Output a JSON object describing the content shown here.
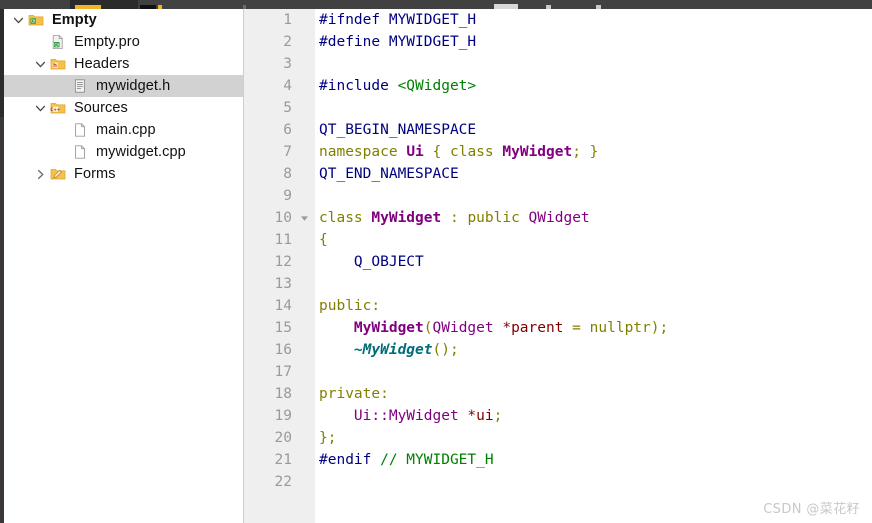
{
  "window": {
    "toolbar_strip_label": "toolbar (cropped)"
  },
  "sidebar": {
    "items": [
      {
        "label": "Empty",
        "icon": "qt-folder-icon",
        "indent": 0,
        "twisty": "expanded",
        "bold": true,
        "selected": false
      },
      {
        "label": "Empty.pro",
        "icon": "qt-profile-file-icon",
        "indent": 1,
        "twisty": "none",
        "bold": false,
        "selected": false
      },
      {
        "label": "Headers",
        "icon": "headers-folder-icon",
        "indent": 1,
        "twisty": "expanded",
        "bold": false,
        "selected": false
      },
      {
        "label": "mywidget.h",
        "icon": "header-file-icon",
        "indent": 2,
        "twisty": "none",
        "bold": false,
        "selected": true
      },
      {
        "label": "Sources",
        "icon": "sources-folder-icon",
        "indent": 1,
        "twisty": "expanded",
        "bold": false,
        "selected": false
      },
      {
        "label": "main.cpp",
        "icon": "source-file-icon",
        "indent": 2,
        "twisty": "none",
        "bold": false,
        "selected": false
      },
      {
        "label": "mywidget.cpp",
        "icon": "source-file-icon",
        "indent": 2,
        "twisty": "none",
        "bold": false,
        "selected": false
      },
      {
        "label": "Forms",
        "icon": "forms-folder-icon",
        "indent": 1,
        "twisty": "collapsed",
        "bold": false,
        "selected": false
      }
    ]
  },
  "editor": {
    "file": "mywidget.h",
    "total_lines": 22,
    "lines": [
      {
        "n": "1",
        "fold": false,
        "tokens": [
          {
            "t": "#ifndef ",
            "c": "preproc"
          },
          {
            "t": "MYWIDGET_H",
            "c": "preproc"
          }
        ]
      },
      {
        "n": "2",
        "fold": false,
        "tokens": [
          {
            "t": "#define ",
            "c": "preproc"
          },
          {
            "t": "MYWIDGET_H",
            "c": "preproc"
          }
        ]
      },
      {
        "n": "3",
        "fold": false,
        "tokens": []
      },
      {
        "n": "4",
        "fold": false,
        "tokens": [
          {
            "t": "#include ",
            "c": "preproc"
          },
          {
            "t": "<QWidget>",
            "c": "string"
          }
        ]
      },
      {
        "n": "5",
        "fold": false,
        "tokens": []
      },
      {
        "n": "6",
        "fold": false,
        "tokens": [
          {
            "t": "QT_BEGIN_NAMESPACE",
            "c": "preproc"
          }
        ]
      },
      {
        "n": "7",
        "fold": false,
        "tokens": [
          {
            "t": "namespace ",
            "c": "keyword"
          },
          {
            "t": "Ui",
            "c": "typebold"
          },
          {
            "t": " { ",
            "c": "punct"
          },
          {
            "t": "class ",
            "c": "keyword"
          },
          {
            "t": "MyWidget",
            "c": "typebold"
          },
          {
            "t": "; }",
            "c": "punct"
          }
        ]
      },
      {
        "n": "8",
        "fold": false,
        "tokens": [
          {
            "t": "QT_END_NAMESPACE",
            "c": "preproc"
          }
        ]
      },
      {
        "n": "9",
        "fold": false,
        "tokens": []
      },
      {
        "n": "10",
        "fold": true,
        "tokens": [
          {
            "t": "class ",
            "c": "keyword"
          },
          {
            "t": "MyWidget",
            "c": "typebold"
          },
          {
            "t": " : ",
            "c": "punct"
          },
          {
            "t": "public ",
            "c": "keyword"
          },
          {
            "t": "QWidget",
            "c": "type"
          }
        ]
      },
      {
        "n": "11",
        "fold": false,
        "tokens": [
          {
            "t": "{",
            "c": "punct"
          }
        ]
      },
      {
        "n": "12",
        "fold": false,
        "tokens": [
          {
            "t": "    Q_OBJECT",
            "c": "preproc"
          }
        ]
      },
      {
        "n": "13",
        "fold": false,
        "tokens": []
      },
      {
        "n": "14",
        "fold": false,
        "tokens": [
          {
            "t": "public",
            "c": "keyword"
          },
          {
            "t": ":",
            "c": "punct"
          }
        ]
      },
      {
        "n": "15",
        "fold": false,
        "tokens": [
          {
            "t": "    ",
            "c": "plain"
          },
          {
            "t": "MyWidget",
            "c": "typebold"
          },
          {
            "t": "(",
            "c": "punct"
          },
          {
            "t": "QWidget",
            "c": "type"
          },
          {
            "t": " ",
            "c": "plain"
          },
          {
            "t": "*parent",
            "c": "var"
          },
          {
            "t": " = ",
            "c": "punct"
          },
          {
            "t": "nullptr",
            "c": "keyword"
          },
          {
            "t": ");",
            "c": "punct"
          }
        ]
      },
      {
        "n": "16",
        "fold": false,
        "tokens": [
          {
            "t": "    ~MyWidget",
            "c": "occur"
          },
          {
            "t": "();",
            "c": "punct"
          }
        ]
      },
      {
        "n": "17",
        "fold": false,
        "tokens": []
      },
      {
        "n": "18",
        "fold": false,
        "tokens": [
          {
            "t": "private",
            "c": "keyword"
          },
          {
            "t": ":",
            "c": "punct"
          }
        ]
      },
      {
        "n": "19",
        "fold": false,
        "tokens": [
          {
            "t": "    ",
            "c": "plain"
          },
          {
            "t": "Ui::MyWidget",
            "c": "type"
          },
          {
            "t": " ",
            "c": "plain"
          },
          {
            "t": "*ui",
            "c": "var"
          },
          {
            "t": ";",
            "c": "punct"
          }
        ]
      },
      {
        "n": "20",
        "fold": false,
        "tokens": [
          {
            "t": "};",
            "c": "punct"
          }
        ]
      },
      {
        "n": "21",
        "fold": false,
        "tokens": [
          {
            "t": "#endif ",
            "c": "preproc"
          },
          {
            "t": "// MYWIDGET_H",
            "c": "comment"
          }
        ]
      },
      {
        "n": "22",
        "fold": false,
        "tokens": []
      }
    ]
  },
  "watermark": {
    "text": "CSDN @菜花籽"
  },
  "colors": {
    "preprocessor": "#000080",
    "string": "#008000",
    "keyword": "#808000",
    "type": "#800080",
    "variable": "#800000",
    "comment": "#008000",
    "occurrence": "#006e7a",
    "gutter_bg": "#efefef",
    "selection_bg": "#d2d2d2",
    "editor_bg": "#ffffff",
    "toolbar_bg": "#414141"
  }
}
